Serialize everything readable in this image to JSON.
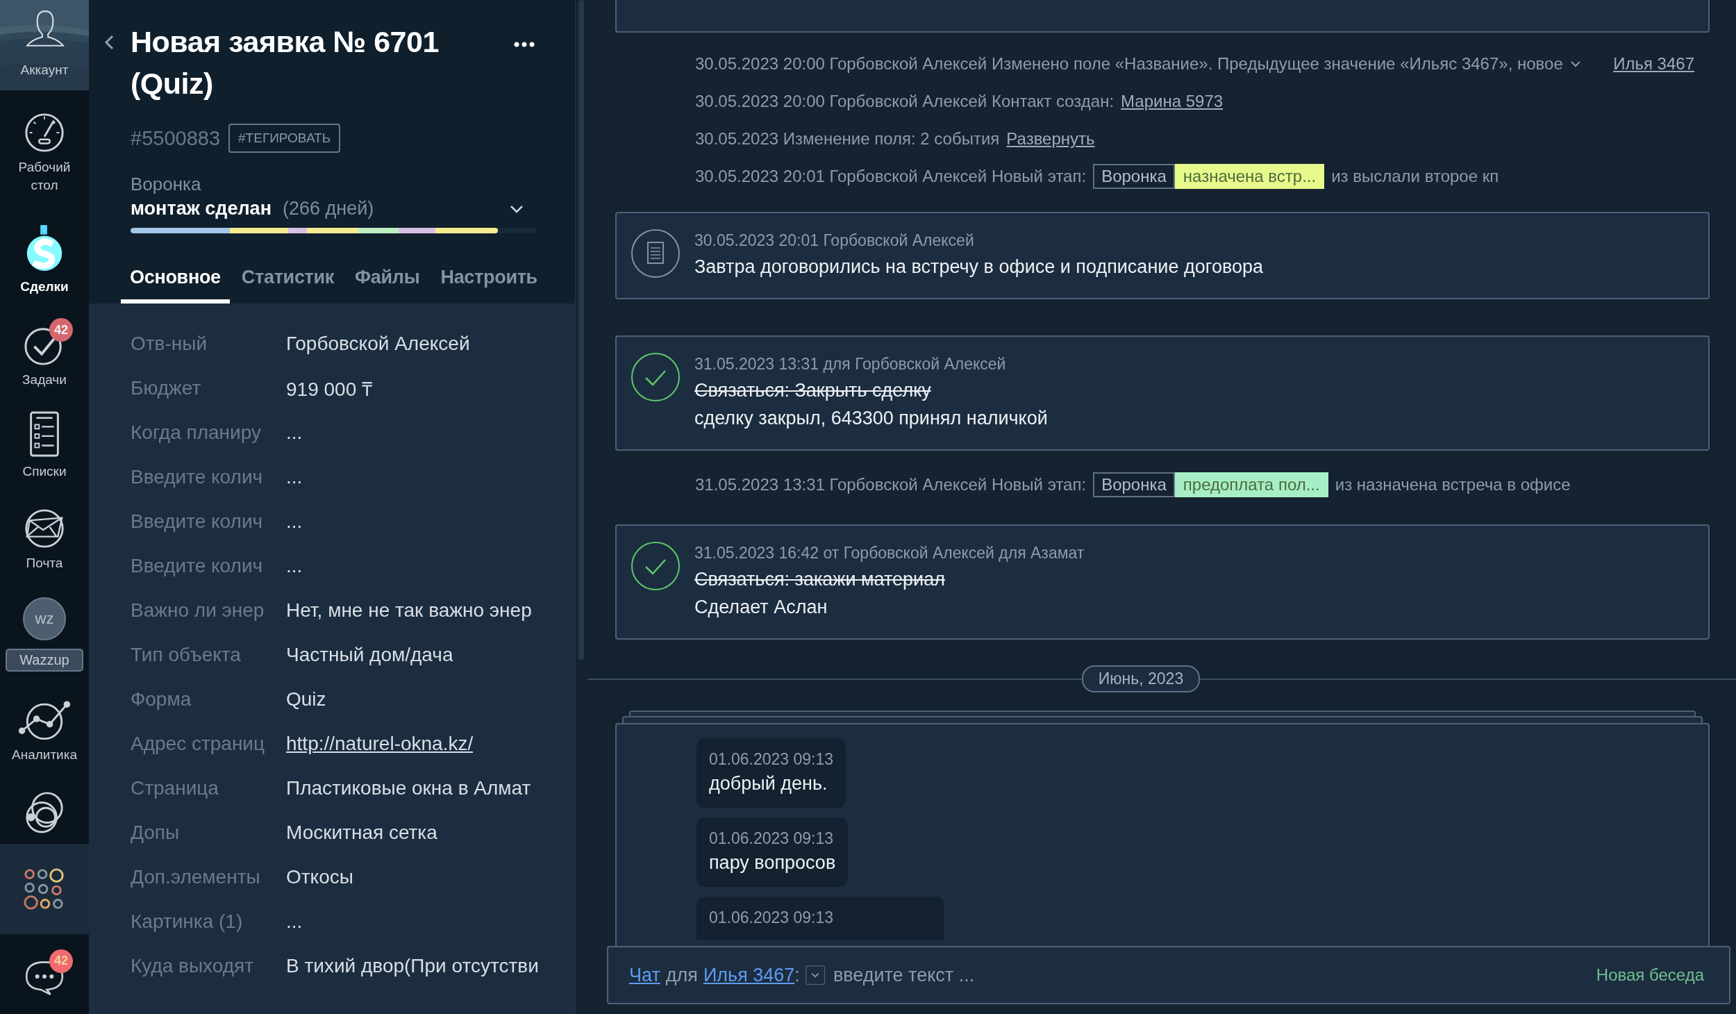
{
  "sidebar": {
    "account": {
      "label": "Аккаунт"
    },
    "items": [
      {
        "kind": "dashboard",
        "label": "Рабочий стол",
        "selected": false
      },
      {
        "kind": "deals",
        "label": "Сделки",
        "selected": true
      },
      {
        "kind": "tasks",
        "label": "Задачи",
        "badge": "42",
        "selected": false
      },
      {
        "kind": "lists",
        "label": "Списки",
        "selected": false
      },
      {
        "kind": "mail",
        "label": "Почта",
        "selected": false
      },
      {
        "kind": "wazzup",
        "icon_text": "wz",
        "label": "Wazzup",
        "selected": false
      },
      {
        "kind": "analytics",
        "label": "Аналитика",
        "selected": false
      },
      {
        "kind": "circles",
        "selected": false
      },
      {
        "kind": "apps",
        "selected": false
      },
      {
        "kind": "chat",
        "badge": "42",
        "selected": false
      }
    ]
  },
  "lead": {
    "title": "Новая заявка № 6701 (Quiz)",
    "id": "#5500883",
    "tag_button": "#ТЕГИРОВАТЬ",
    "pipeline_label": "Воронка",
    "stage": "монтаж сделан",
    "duration": "(266 дней)",
    "level": 0.905,
    "tabs": [
      {
        "label": "Основное",
        "selected": true
      },
      {
        "label": "Статистик",
        "selected": false
      },
      {
        "label": "Файлы",
        "selected": false
      },
      {
        "label": "Настроить",
        "selected": false
      }
    ],
    "fields": [
      {
        "label": "Отв-ный",
        "value": "Горбовской Алексей",
        "kind": "text"
      },
      {
        "label": "Бюджет",
        "value": "919 000 ₸",
        "kind": "text"
      },
      {
        "label": "Когда планиру",
        "value": "...",
        "kind": "text"
      },
      {
        "label": "Введите колич",
        "value": "...",
        "kind": "text"
      },
      {
        "label": "Введите колич",
        "value": "...",
        "kind": "text"
      },
      {
        "label": "Введите колич",
        "value": "...",
        "kind": "text"
      },
      {
        "label": "Важно ли энер",
        "value": "Нет, мне не так важно энер",
        "kind": "text"
      },
      {
        "label": "Тип объекта",
        "value": "Частный дом/дача",
        "kind": "text"
      },
      {
        "label": "Форма",
        "value": "Quiz",
        "kind": "text"
      },
      {
        "label": "Адрес страниц",
        "value": "http://naturel-okna.kz/",
        "kind": "link"
      },
      {
        "label": "Страница",
        "value": "Пластиковые окна в Алмат",
        "kind": "text"
      },
      {
        "label": "Допы",
        "value": "Москитная сетка",
        "kind": "text"
      },
      {
        "label": "Доп.элементы",
        "value": "Откосы",
        "kind": "text"
      },
      {
        "label": "Картинка (1)",
        "value": "...",
        "kind": "text"
      },
      {
        "label": "Куда выходят",
        "value": "В тихий двор(При отсутстви",
        "kind": "text"
      }
    ]
  },
  "feed": [
    {
      "kind": "cut_card"
    },
    {
      "kind": "event",
      "text": "30.05.2023 20:00 Горбовской Алексей Изменено поле «Название». Предыдущее значение «Ильяс 3467», новое",
      "expandable": true,
      "link": "Илья 3467",
      "link_right": true
    },
    {
      "kind": "event",
      "text": "30.05.2023 20:00 Горбовской Алексей Контакт создан:",
      "link": "Марина 5973",
      "link_right": false
    },
    {
      "kind": "event",
      "text": "30.05.2023 Изменение поля: 2 события",
      "link": "Развернуть",
      "link_right": false
    },
    {
      "kind": "event",
      "text": "30.05.2023 20:01 Горбовской Алексей Новый этап:",
      "stage": {
        "pipeline": "Воронка",
        "name": "назначена встр...",
        "color": "#e6f98a"
      },
      "after": "из выслали второе кп"
    },
    {
      "kind": "note",
      "meta": "30.05.2023 20:01 Горбовской Алексей",
      "text": "Завтра договорились на встречу в офисе и подписание договора"
    },
    {
      "kind": "task",
      "meta": "31.05.2023 13:31  для Горбовской Алексей",
      "title": "Связаться: Закрыть сделку",
      "completed": true,
      "result": "сделку закрыл, 643300 принял наличкой"
    },
    {
      "kind": "event",
      "text": "31.05.2023 13:31 Горбовской Алексей Новый этап:",
      "stage": {
        "pipeline": "Воронка",
        "name": "предоплата пол...",
        "color": "#a6efc6"
      },
      "after": "из назначена встреча в офисе"
    },
    {
      "kind": "task",
      "meta": "31.05.2023 16:42  от Горбовской Алексей для Азамат",
      "title": "Связаться: закажи материал",
      "completed": true,
      "result": "Сделает Аслан"
    },
    {
      "kind": "divider",
      "label": "Июнь, 2023"
    },
    {
      "kind": "chat",
      "messages": [
        {
          "time": "01.06.2023 09:13",
          "text": "добрый день."
        },
        {
          "time": "01.06.2023 09:13",
          "text": "пару вопросов"
        },
        {
          "time": "01.06.2023 09:13"
        }
      ]
    }
  ],
  "composer": {
    "chat_link": "Чат",
    "for": "для",
    "contact_link": "Илья 3467",
    "colon": ":",
    "placeholder": "введите текст ...",
    "new_button": "Новая беседа"
  }
}
